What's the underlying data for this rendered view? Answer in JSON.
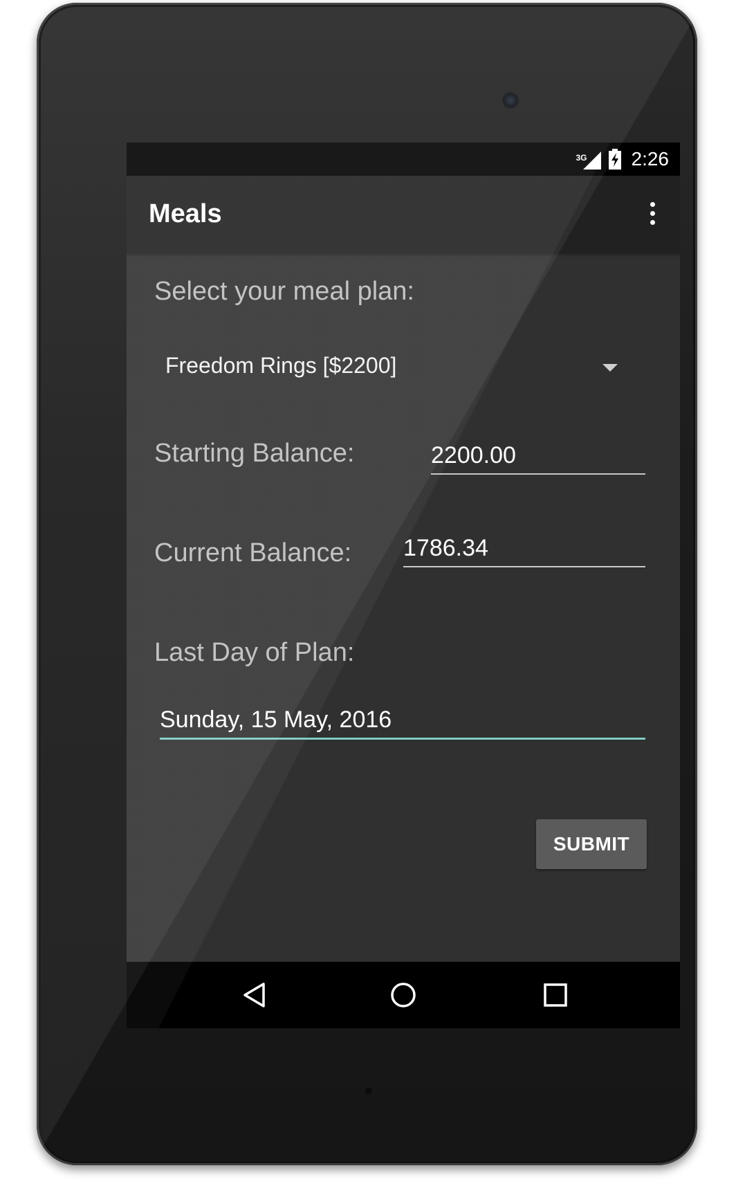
{
  "status_bar": {
    "network_type": "3G",
    "time": "2:26",
    "icons": [
      "signal-icon",
      "battery-charging-icon"
    ]
  },
  "app_bar": {
    "title": "Meals",
    "menu_icon": "overflow-menu-icon"
  },
  "form": {
    "meal_plan_label": "Select your meal plan:",
    "meal_plan_selected": "Freedom Rings [$2200]",
    "starting_balance_label": "Starting Balance:",
    "starting_balance_value": "2200.00",
    "current_balance_label": "Current Balance:",
    "current_balance_value": "1786.34",
    "last_day_label": "Last Day of Plan:",
    "last_day_value": "Sunday, 15 May, 2016",
    "submit_label": "SUBMIT"
  },
  "nav_bar": {
    "icons": [
      "back-icon",
      "home-icon",
      "recents-icon"
    ]
  },
  "colors": {
    "screen_background": "#303030",
    "app_bar": "#212121",
    "accent_underline": "#80cbc4",
    "button": "#5b5b5b"
  }
}
